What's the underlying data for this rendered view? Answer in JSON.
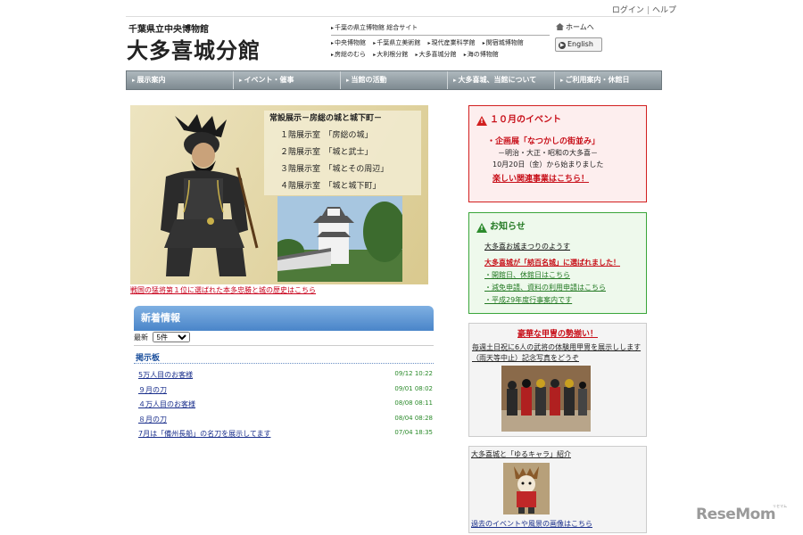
{
  "util": {
    "login": "ログイン",
    "sep": "|",
    "help": "ヘルプ"
  },
  "header": {
    "org": "千葉県立中央博物館",
    "site": "大多喜城分館",
    "links_row1": [
      "千葉の県立博物館 総合サイト"
    ],
    "links_row2": [
      "中央博物館",
      "千葉県立美術館",
      "現代産業科学館",
      "関宿城博物館"
    ],
    "links_row3": [
      "房総のむら",
      "大利根分館",
      "大多喜城分館",
      "海の博物館"
    ],
    "home": "ホームへ",
    "english": "English"
  },
  "nav": [
    "展示案内",
    "イベント・催事",
    "当館の活動",
    "大多喜城、当館について",
    "ご利用案内・休館日"
  ],
  "hero": {
    "exhibit_title": "常設展示－房総の城と城下町－",
    "lines": [
      "１階展示室　「房総の城」",
      "２階展示室　「城と武士」",
      "３階展示室　「城とその周辺」",
      "４階展示室　「城と城下町」"
    ],
    "caption": "戦国の猛将第１位に選ばれた本多忠勝と城の歴史はこちら"
  },
  "news": {
    "title": "新着情報",
    "latest_label": "最新",
    "select_value": "5件",
    "board": "掲示板",
    "posts": [
      {
        "title": "5万人目のお客様",
        "date": "09/12 10:22"
      },
      {
        "title": "９月の刀",
        "date": "09/01 08:02"
      },
      {
        "title": "４万人目のお客様",
        "date": "08/08 08:11"
      },
      {
        "title": "８月の刀",
        "date": "08/04 08:28"
      },
      {
        "title": "7月は「備州長船」の名刀を展示してます",
        "date": "07/04 18:35"
      }
    ]
  },
  "event_box": {
    "title": "１０月のイベント",
    "item": "・企画展「なつかしの街並み」",
    "sub1": "－明治・大正・昭和の大多喜－",
    "sub2": "10月20日（金）から始まりました",
    "link": "楽しい関連事業はこちら！"
  },
  "notice_box": {
    "title": "お知らせ",
    "item1": "大多喜お城まつりのようす",
    "item2": "大多喜城が「続百名城」に選ばれました！",
    "items": [
      "・開館日、休館日はこちら",
      "・減免申請、資料の利用申請はこちら",
      "・平成29年度行事案内です"
    ]
  },
  "armor_panel": {
    "title": "豪華な甲冑の勢揃い！",
    "desc": "毎週土日祝に6人の武将の体験用甲冑を展示しします（雨天等中止）記念写真をどうぞ"
  },
  "yuru_panel": {
    "title": "大多喜城と「ゆるキャラ」紹介",
    "footer": "過去のイベントや風景の画像はこちら"
  },
  "watermark": {
    "text": "ReseMom",
    "sub": "リセマム"
  }
}
